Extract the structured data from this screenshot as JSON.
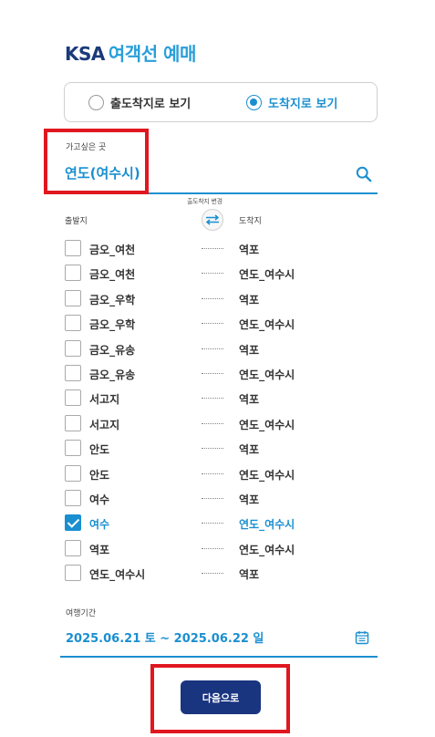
{
  "header": {
    "brand": "KSA",
    "subtitle": "여객선 예매"
  },
  "view_toggle": {
    "options": [
      {
        "label": "출도착지로 보기",
        "selected": false
      },
      {
        "label": "도착지로 보기",
        "selected": true
      }
    ]
  },
  "destination": {
    "label": "가고싶은 곳",
    "value": "연도(여수시)",
    "icon": "search-icon"
  },
  "route_header": {
    "departure": "출발지",
    "arrival": "도착지",
    "swap_label": "출도착지 변경",
    "swap_icon": "swap-arrows-icon"
  },
  "routes": [
    {
      "departure": "금오_여천",
      "arrival": "역포",
      "checked": false
    },
    {
      "departure": "금오_여천",
      "arrival": "연도_여수시",
      "checked": false
    },
    {
      "departure": "금오_우학",
      "arrival": "역포",
      "checked": false
    },
    {
      "departure": "금오_우학",
      "arrival": "연도_여수시",
      "checked": false
    },
    {
      "departure": "금오_유송",
      "arrival": "역포",
      "checked": false
    },
    {
      "departure": "금오_유송",
      "arrival": "연도_여수시",
      "checked": false
    },
    {
      "departure": "서고지",
      "arrival": "역포",
      "checked": false
    },
    {
      "departure": "서고지",
      "arrival": "연도_여수시",
      "checked": false
    },
    {
      "departure": "안도",
      "arrival": "역포",
      "checked": false
    },
    {
      "departure": "안도",
      "arrival": "연도_여수시",
      "checked": false
    },
    {
      "departure": "여수",
      "arrival": "역포",
      "checked": false
    },
    {
      "departure": "여수",
      "arrival": "연도_여수시",
      "checked": true
    },
    {
      "departure": "역포",
      "arrival": "연도_여수시",
      "checked": false
    },
    {
      "departure": "연도_여수시",
      "arrival": "역포",
      "checked": false
    }
  ],
  "travel_period": {
    "label": "여행기간",
    "value": "2025.06.21 토 ~ 2025.06.22 일",
    "icon": "calendar-icon"
  },
  "next_button": {
    "label": "다음으로"
  },
  "colors": {
    "accent": "#1a8fd0",
    "brand": "#1a3a7a",
    "button": "#1a3580",
    "highlight": "#e0171f"
  }
}
